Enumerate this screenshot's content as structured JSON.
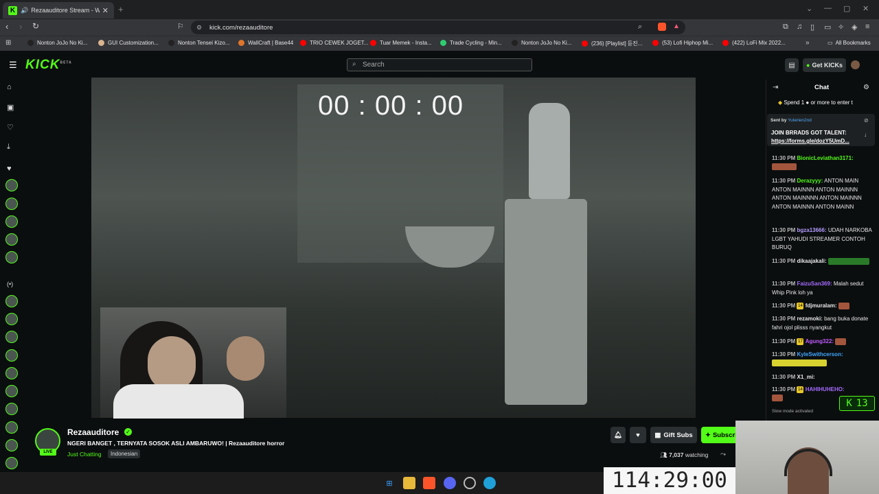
{
  "browser": {
    "tab_title": "Rezaauditore Stream - Watch",
    "tab_close": "✕",
    "new_tab": "+",
    "url": "kick.com/rezaauditore",
    "bookmarks": [
      {
        "label": "Nonton JoJo No Ki...",
        "color": "#222222"
      },
      {
        "label": "GUI Customization...",
        "color": "#d9b48f"
      },
      {
        "label": "Nonton Tensei Kizo...",
        "color": "#222222"
      },
      {
        "label": "WallCraft | Base44",
        "color": "#e0762c"
      },
      {
        "label": "TRIO CEWEK JOGET...",
        "color": "#ff0000"
      },
      {
        "label": "Tuar Memek - Insta...",
        "color": "#ff0000"
      },
      {
        "label": "Trade Cycling - Min...",
        "color": "#2ecc71"
      },
      {
        "label": "Nonton JoJo No Ki...",
        "color": "#222222"
      },
      {
        "label": "(236) [Playlist] 듣진...",
        "color": "#ff0000"
      },
      {
        "label": "(53) Lofi Hiphop Mi...",
        "color": "#ff0000"
      },
      {
        "label": "(422) LoFi Mix 2022...",
        "color": "#ff0000"
      }
    ],
    "all_bookmarks": "All Bookmarks"
  },
  "kick": {
    "logo": "KICK",
    "logo_beta": "BETA",
    "search_placeholder": "Search",
    "get_kicks": "Get KICKs"
  },
  "video": {
    "timer": "00 : 00 : 00"
  },
  "channel": {
    "name": "Rezaauditore",
    "live": "LIVE",
    "title": "NGERI BANGET , TERNYATA SOSOK ASLI AMBARUWO! | Rezaauditore horror",
    "category": "Just Chatting",
    "tag": "Indonesian",
    "gift_subs": "Gift Subs",
    "subscribe": "Subscribe",
    "watching": "watching",
    "watching_count": "7,037"
  },
  "overlay": {
    "big_timer": "114:29:00",
    "kick_count": "13"
  },
  "chat": {
    "header": "Chat",
    "spend_banner": "Spend 1 ● or more to enter t",
    "pinned_sent_by": "Sent by",
    "pinned_user": "Yuterien2nd",
    "pinned_line1": "JOIN BRRADS GOT TALENT:",
    "pinned_line2": "https://forms.gle/dozY5UmD...",
    "messages": [
      {
        "time": "11:30 PM",
        "user": "BionicLeviathan3171:",
        "color": "#53fc18",
        "text": ""
      },
      {
        "time": "11:30 PM",
        "user": "Derazyyy:",
        "color": "#53fc18",
        "text": "ANTON MAIN ANTON MAINNN ANTON MAINNN ANTON MAINNNN ANTON MAINNN ANTON MAINNN ANTON MAINN"
      },
      {
        "time": "11:30 PM",
        "user": "bgza13666:",
        "color": "#b49cff",
        "text": "UDAH NARKOBA LGBT YAHUDI STREAMER CONTOH BURUQ"
      },
      {
        "time": "11:30 PM",
        "user": "dikaajakali:",
        "color": "#fff",
        "text": ""
      },
      {
        "time": "11:30 PM",
        "user": "FaizuSan369:",
        "color": "#a56bff",
        "text": "Malah sedut Whip Pink loh ya"
      },
      {
        "time": "11:30 PM",
        "user": "fdjmuralam:",
        "color": "#fff",
        "text": ""
      },
      {
        "time": "11:30 PM",
        "user": "rezamoki:",
        "color": "#fff",
        "text": "bang buka donate fahri ojol plisss nyangkut"
      },
      {
        "time": "11:30 PM",
        "user": "Agung322:",
        "color": "#c25cff",
        "text": ""
      },
      {
        "time": "11:30 PM",
        "user": "KyleSwithcerson:",
        "color": "#40a6ff",
        "text": ""
      },
      {
        "time": "11:30 PM",
        "user": "X1_mi:",
        "color": "#fff",
        "text": ""
      },
      {
        "time": "11:30 PM",
        "user": "HAHIHUHEHO:",
        "color": "#a56bff",
        "text": ""
      }
    ],
    "slow_mode": "Slow mode activated"
  }
}
